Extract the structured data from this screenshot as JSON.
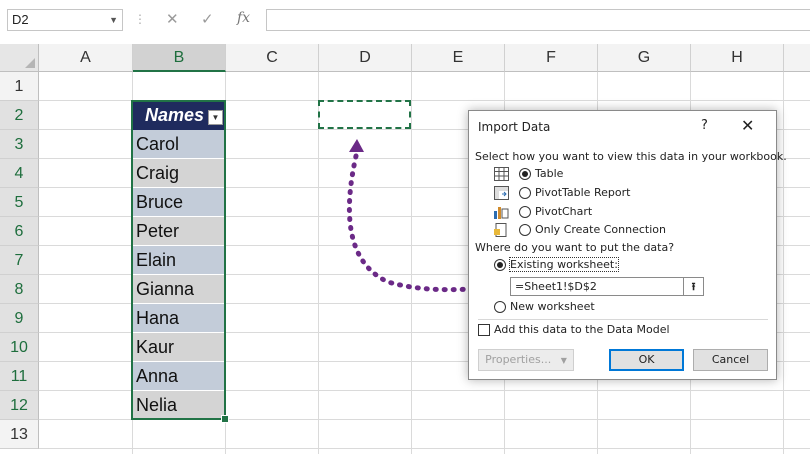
{
  "formula_bar": {
    "name_box": "D2",
    "cancel_icon": "✕",
    "enter_icon": "✓",
    "fx_label": "fx",
    "formula": ""
  },
  "columns": [
    "A",
    "B",
    "C",
    "D",
    "E",
    "F",
    "G",
    "H"
  ],
  "selected_column": "B",
  "rows": [
    "1",
    "2",
    "3",
    "4",
    "5",
    "6",
    "7",
    "8",
    "9",
    "10",
    "11",
    "12",
    "13"
  ],
  "table": {
    "header": "Names",
    "values": [
      "Carol",
      "Craig",
      "Bruce",
      "Peter",
      "Elain",
      "Gianna",
      "Hana",
      "Kaur",
      "Anna",
      "Nelia"
    ]
  },
  "dialog": {
    "title": "Import Data",
    "help": "?",
    "close": "✕",
    "view_prompt": "Select how you want to view this data in your workbook.",
    "view_options": [
      "Table",
      "PivotTable Report",
      "PivotChart",
      "Only Create Connection"
    ],
    "view_selected": "Table",
    "place_prompt": "Where do you want to put the data?",
    "existing_worksheet": "Existing worksheet:",
    "reference": "=Sheet1!$D$2",
    "new_worksheet": "New worksheet",
    "data_model": "Add this data to the Data Model",
    "properties_button": "Properties...",
    "ok_button": "OK",
    "cancel_button": "Cancel"
  },
  "colors": {
    "excel_green": "#217346",
    "table_header": "#1f2b5e",
    "band_blue": "#c3ccd9",
    "band_gray": "#d4d4d4",
    "arrow_purple": "#6b2a87"
  }
}
